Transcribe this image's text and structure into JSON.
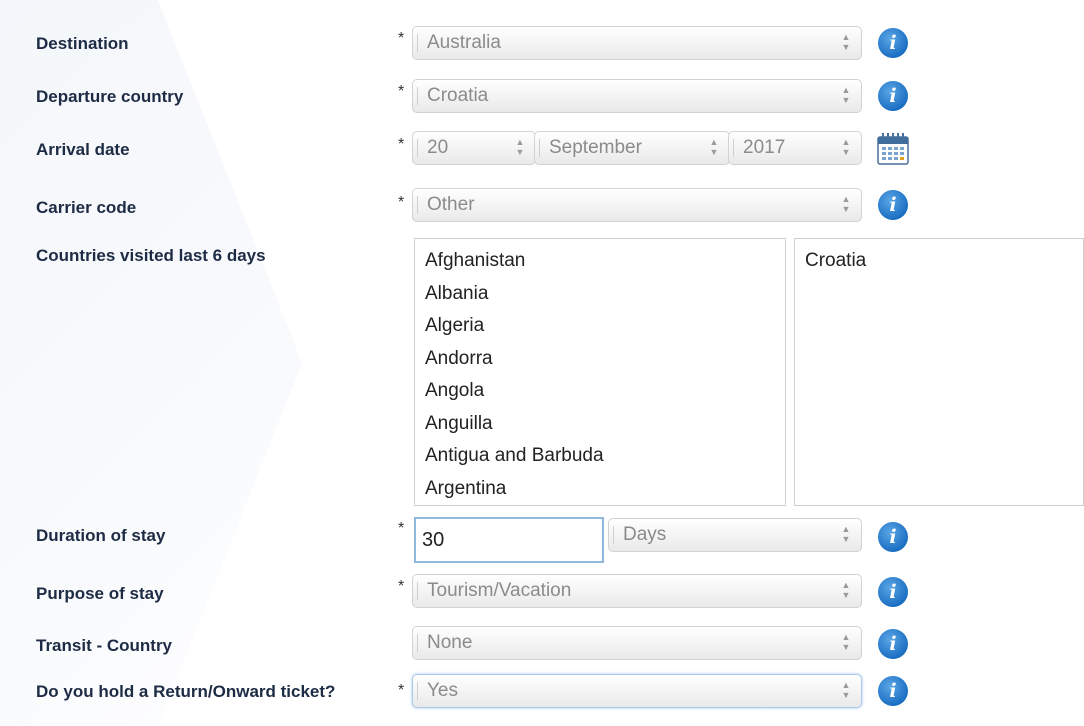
{
  "form": {
    "destination": {
      "label": "Destination",
      "required": "*",
      "value": "Australia",
      "info": "i"
    },
    "departure": {
      "label": "Departure country",
      "required": "*",
      "value": "Croatia",
      "info": "i"
    },
    "arrival": {
      "label": "Arrival date",
      "required": "*",
      "day": "20",
      "month": "September",
      "year": "2017",
      "calendar_icon": "calendar-icon"
    },
    "carrier": {
      "label": "Carrier code",
      "required": "*",
      "value": "Other",
      "info": "i"
    },
    "countries_visited": {
      "label": "Countries visited last 6 days",
      "available": [
        "Afghanistan",
        "Albania",
        "Algeria",
        "Andorra",
        "Angola",
        "Anguilla",
        "Antigua and Barbuda",
        "Argentina"
      ],
      "selected": [
        "Croatia"
      ]
    },
    "duration": {
      "label": "Duration of stay",
      "required": "*",
      "value": "30",
      "unit": "Days",
      "info": "i"
    },
    "purpose": {
      "label": "Purpose of stay",
      "required": "*",
      "value": "Tourism/Vacation",
      "info": "i"
    },
    "transit": {
      "label": "Transit - Country",
      "value": "None",
      "info": "i"
    },
    "return_ticket": {
      "label": "Do you hold a Return/Onward ticket?",
      "required": "*",
      "value": "Yes",
      "info": "i"
    }
  },
  "colors": {
    "info_blue": "#1c6fc3",
    "label_text": "#1d2b44",
    "select_text": "#8b8b8b"
  }
}
